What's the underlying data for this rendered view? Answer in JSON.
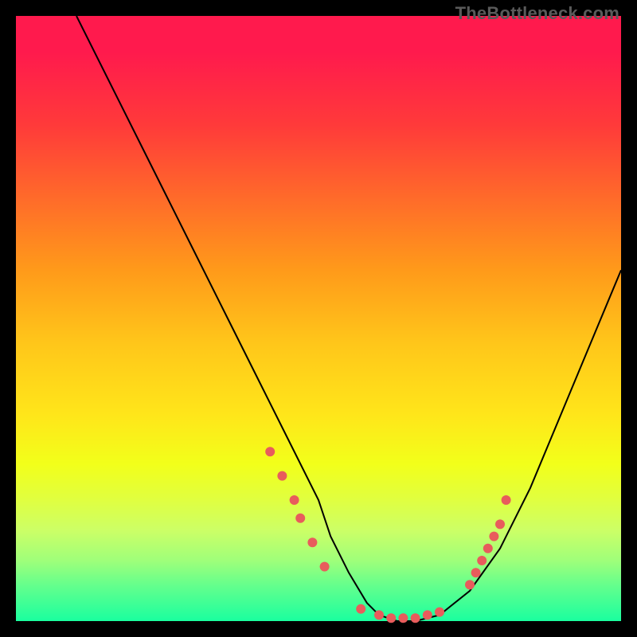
{
  "watermark": "TheBottleneck.com",
  "chart_data": {
    "type": "line",
    "title": "",
    "xlabel": "",
    "ylabel": "",
    "xlim": [
      0,
      100
    ],
    "ylim": [
      0,
      100
    ],
    "grid": false,
    "legend": false,
    "series": [
      {
        "name": "curve",
        "x": [
          10,
          15,
          20,
          25,
          30,
          35,
          40,
          45,
          50,
          52,
          55,
          58,
          60,
          63,
          66,
          70,
          75,
          80,
          85,
          90,
          95,
          100
        ],
        "y": [
          100,
          90,
          80,
          70,
          60,
          50,
          40,
          30,
          20,
          14,
          8,
          3,
          1,
          0,
          0,
          1,
          5,
          12,
          22,
          34,
          46,
          58
        ],
        "stroke": "#000000",
        "stroke_width": 2
      }
    ],
    "markers": [
      {
        "name": "left-cluster",
        "color": "#e85c5c",
        "r": 6,
        "points": [
          {
            "x": 42,
            "y": 28
          },
          {
            "x": 44,
            "y": 24
          },
          {
            "x": 46,
            "y": 20
          },
          {
            "x": 47,
            "y": 17
          },
          {
            "x": 49,
            "y": 13
          },
          {
            "x": 51,
            "y": 9
          }
        ]
      },
      {
        "name": "bottom-cluster",
        "color": "#e85c5c",
        "r": 6,
        "points": [
          {
            "x": 57,
            "y": 2
          },
          {
            "x": 60,
            "y": 1
          },
          {
            "x": 62,
            "y": 0.5
          },
          {
            "x": 64,
            "y": 0.5
          },
          {
            "x": 66,
            "y": 0.5
          },
          {
            "x": 68,
            "y": 1
          },
          {
            "x": 70,
            "y": 1.5
          }
        ]
      },
      {
        "name": "right-cluster",
        "color": "#e85c5c",
        "r": 6,
        "points": [
          {
            "x": 75,
            "y": 6
          },
          {
            "x": 76,
            "y": 8
          },
          {
            "x": 77,
            "y": 10
          },
          {
            "x": 78,
            "y": 12
          },
          {
            "x": 79,
            "y": 14
          },
          {
            "x": 80,
            "y": 16
          },
          {
            "x": 81,
            "y": 20
          }
        ]
      }
    ]
  }
}
